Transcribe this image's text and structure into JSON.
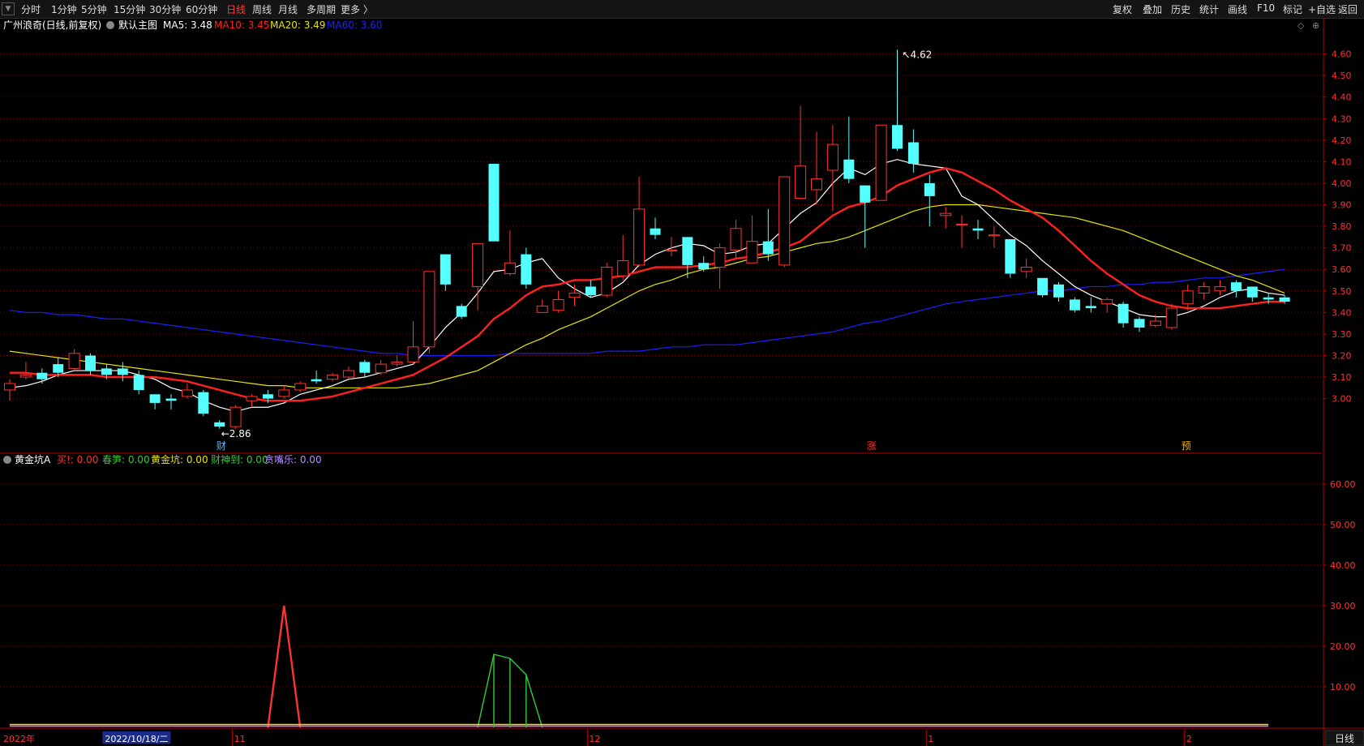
{
  "toolbar": {
    "logo": "▼",
    "periods": [
      "分时",
      "1分钟",
      "5分钟",
      "15分钟",
      "30分钟",
      "60分钟",
      "日线",
      "周线",
      "月线",
      "多周期",
      "更多 〉"
    ],
    "active_period": "日线",
    "right_buttons": [
      "复权",
      "叠加",
      "历史",
      "统计",
      "画线",
      "F10",
      "标记",
      "+自选",
      "返回"
    ]
  },
  "main_legend": {
    "stock": "广州浪奇(日线,前复权)",
    "template": "默认主图",
    "ma5": "MA5: 3.48",
    "ma10": "MA10: 3.45",
    "ma20": "MA20: 3.49",
    "ma60": "MA60: 3.60"
  },
  "sub_legend": {
    "name": "黄金坑A",
    "items": [
      {
        "text": "买!: 0.00",
        "color": "#ff3333"
      },
      {
        "text": "春笋: 0.00",
        "color": "#33cc33"
      },
      {
        "text": "黄金坑: 0.00",
        "color": "#e6e600"
      },
      {
        "text": "财神到: 0.00",
        "color": "#33cc33"
      },
      {
        "text": "贪嘴乐: 0.00",
        "color": "#b28dff"
      }
    ]
  },
  "markers": {
    "high": "4.62",
    "low": "2.86",
    "cai": "财",
    "zhang": "涨",
    "yu": "预"
  },
  "x_axis": {
    "labels": [
      {
        "text": "2022年",
        "i": 0
      },
      {
        "text": "2022/10/18/二",
        "i": 6
      },
      {
        "text": "11",
        "i": 14
      },
      {
        "text": "12",
        "i": 36
      },
      {
        "text": "1",
        "i": 57
      },
      {
        "text": "2",
        "i": 73
      }
    ]
  },
  "period_tag": "日线",
  "colors": {
    "up": "#ff3232",
    "down": "#54ffff",
    "ma5": "#ffffff",
    "ma10": "#ff2020",
    "ma20": "#e6e600",
    "ma60": "#1e1eff",
    "grid": "#7a0000",
    "axis": "#b40000"
  },
  "chart_data": [
    {
      "type": "candlestick",
      "title": "广州浪奇(日线,前复权)",
      "ylim": [
        2.75,
        4.7
      ],
      "yticks": [
        3.0,
        3.1,
        3.2,
        3.3,
        3.4,
        3.5,
        3.6,
        3.7,
        3.8,
        3.9,
        4.0,
        4.1,
        4.2,
        4.3,
        4.4,
        4.5,
        4.6
      ],
      "candles": [
        [
          3.04,
          3.07,
          3.09,
          2.99
        ],
        [
          3.1,
          3.11,
          3.17,
          3.09
        ],
        [
          3.12,
          3.09,
          3.14,
          3.07
        ],
        [
          3.16,
          3.12,
          3.19,
          3.1
        ],
        [
          3.14,
          3.21,
          3.23,
          3.13
        ],
        [
          3.2,
          3.13,
          3.21,
          3.11
        ],
        [
          3.14,
          3.11,
          3.16,
          3.09
        ],
        [
          3.14,
          3.11,
          3.17,
          3.08
        ],
        [
          3.11,
          3.04,
          3.13,
          3.02
        ],
        [
          3.02,
          2.98,
          3.02,
          2.95
        ],
        [
          3.0,
          2.99,
          3.02,
          2.95
        ],
        [
          3.01,
          3.04,
          3.07,
          3.0
        ],
        [
          3.03,
          2.93,
          3.04,
          2.92
        ],
        [
          2.89,
          2.87,
          2.9,
          2.86
        ],
        [
          2.87,
          2.96,
          2.97,
          2.86
        ],
        [
          2.99,
          3.01,
          3.02,
          2.96
        ],
        [
          3.02,
          3.0,
          3.04,
          2.98
        ],
        [
          3.01,
          3.04,
          3.06,
          3.0
        ],
        [
          3.04,
          3.07,
          3.08,
          3.03
        ],
        [
          3.09,
          3.08,
          3.13,
          3.07
        ],
        [
          3.09,
          3.11,
          3.12,
          3.08
        ],
        [
          3.1,
          3.13,
          3.15,
          3.09
        ],
        [
          3.17,
          3.12,
          3.18,
          3.1
        ],
        [
          3.12,
          3.16,
          3.18,
          3.11
        ],
        [
          3.16,
          3.17,
          3.2,
          3.15
        ],
        [
          3.17,
          3.24,
          3.36,
          3.16
        ],
        [
          3.24,
          3.59,
          3.59,
          3.21
        ],
        [
          3.67,
          3.53,
          3.67,
          3.5
        ],
        [
          3.43,
          3.38,
          3.44,
          3.37
        ],
        [
          3.52,
          3.72,
          3.72,
          3.41
        ],
        [
          4.09,
          3.73,
          4.09,
          3.73
        ],
        [
          3.58,
          3.63,
          3.78,
          3.57
        ],
        [
          3.67,
          3.53,
          3.7,
          3.51
        ],
        [
          3.4,
          3.43,
          3.46,
          3.4
        ],
        [
          3.41,
          3.46,
          3.5,
          3.4
        ],
        [
          3.47,
          3.49,
          3.53,
          3.43
        ],
        [
          3.52,
          3.48,
          3.55,
          3.47
        ],
        [
          3.48,
          3.61,
          3.63,
          3.47
        ],
        [
          3.57,
          3.64,
          3.76,
          3.55
        ],
        [
          3.62,
          3.88,
          4.03,
          3.61
        ],
        [
          3.79,
          3.76,
          3.84,
          3.74
        ],
        [
          3.69,
          3.69,
          3.75,
          3.66
        ],
        [
          3.75,
          3.62,
          3.75,
          3.56
        ],
        [
          3.63,
          3.6,
          3.66,
          3.59
        ],
        [
          3.61,
          3.7,
          3.72,
          3.51
        ],
        [
          3.69,
          3.79,
          3.83,
          3.65
        ],
        [
          3.63,
          3.73,
          3.85,
          3.63
        ],
        [
          3.73,
          3.67,
          3.88,
          3.64
        ],
        [
          3.62,
          4.03,
          4.03,
          3.61
        ],
        [
          3.93,
          4.08,
          4.36,
          3.93
        ],
        [
          3.97,
          4.02,
          4.24,
          3.9
        ],
        [
          4.06,
          4.18,
          4.27,
          3.87
        ],
        [
          4.11,
          4.02,
          4.31,
          4.0
        ],
        [
          3.99,
          3.91,
          3.99,
          3.7
        ],
        [
          3.92,
          4.27,
          4.27,
          3.92
        ],
        [
          4.27,
          4.16,
          4.62,
          4.15
        ],
        [
          4.19,
          4.09,
          4.25,
          4.05
        ],
        [
          4.0,
          3.94,
          4.04,
          3.8
        ],
        [
          3.85,
          3.86,
          3.89,
          3.79
        ],
        [
          3.81,
          3.81,
          3.85,
          3.7
        ],
        [
          3.79,
          3.78,
          3.83,
          3.74
        ],
        [
          3.76,
          3.76,
          3.8,
          3.7
        ],
        [
          3.74,
          3.58,
          3.74,
          3.56
        ],
        [
          3.59,
          3.61,
          3.65,
          3.56
        ],
        [
          3.56,
          3.48,
          3.56,
          3.47
        ],
        [
          3.53,
          3.47,
          3.54,
          3.45
        ],
        [
          3.46,
          3.41,
          3.47,
          3.4
        ],
        [
          3.43,
          3.42,
          3.47,
          3.4
        ],
        [
          3.44,
          3.46,
          3.47,
          3.4
        ],
        [
          3.44,
          3.35,
          3.45,
          3.33
        ],
        [
          3.37,
          3.33,
          3.38,
          3.31
        ],
        [
          3.34,
          3.36,
          3.39,
          3.33
        ],
        [
          3.33,
          3.42,
          3.44,
          3.32
        ],
        [
          3.44,
          3.5,
          3.53,
          3.41
        ],
        [
          3.49,
          3.52,
          3.54,
          3.46
        ],
        [
          3.5,
          3.52,
          3.55,
          3.48
        ],
        [
          3.54,
          3.5,
          3.55,
          3.47
        ],
        [
          3.52,
          3.47,
          3.52,
          3.45
        ],
        [
          3.47,
          3.46,
          3.49,
          3.44
        ],
        [
          3.47,
          3.45,
          3.48,
          3.44
        ]
      ],
      "series": [
        {
          "name": "MA5",
          "values": [
            3.05,
            3.06,
            3.08,
            3.11,
            3.13,
            3.13,
            3.13,
            3.13,
            3.11,
            3.09,
            3.05,
            3.03,
            2.99,
            2.96,
            2.94,
            2.96,
            2.96,
            2.98,
            3.02,
            3.04,
            3.06,
            3.09,
            3.1,
            3.12,
            3.14,
            3.16,
            3.24,
            3.33,
            3.4,
            3.49,
            3.59,
            3.6,
            3.63,
            3.65,
            3.56,
            3.51,
            3.47,
            3.49,
            3.54,
            3.62,
            3.67,
            3.7,
            3.72,
            3.71,
            3.67,
            3.68,
            3.71,
            3.72,
            3.79,
            3.86,
            3.91,
            4.0,
            4.07,
            4.04,
            4.09,
            4.11,
            4.09,
            4.08,
            4.07,
            3.94,
            3.9,
            3.83,
            3.76,
            3.71,
            3.64,
            3.58,
            3.52,
            3.48,
            3.45,
            3.42,
            3.39,
            3.38,
            3.38,
            3.4,
            3.43,
            3.47,
            3.5,
            3.51,
            3.49,
            3.48
          ]
        },
        {
          "name": "MA10",
          "values": [
            3.12,
            3.12,
            3.11,
            3.11,
            3.11,
            3.11,
            3.1,
            3.1,
            3.1,
            3.1,
            3.09,
            3.08,
            3.06,
            3.04,
            3.02,
            3.0,
            2.99,
            2.99,
            2.99,
            3.0,
            3.01,
            3.03,
            3.05,
            3.07,
            3.09,
            3.11,
            3.15,
            3.19,
            3.24,
            3.29,
            3.37,
            3.42,
            3.48,
            3.52,
            3.53,
            3.55,
            3.55,
            3.56,
            3.57,
            3.59,
            3.61,
            3.61,
            3.61,
            3.62,
            3.63,
            3.65,
            3.66,
            3.68,
            3.7,
            3.73,
            3.79,
            3.85,
            3.89,
            3.91,
            3.94,
            3.99,
            4.02,
            4.05,
            4.07,
            4.05,
            4.01,
            3.97,
            3.92,
            3.88,
            3.84,
            3.78,
            3.71,
            3.64,
            3.58,
            3.53,
            3.48,
            3.45,
            3.43,
            3.42,
            3.42,
            3.42,
            3.43,
            3.44,
            3.45,
            3.45
          ]
        },
        {
          "name": "MA20",
          "values": [
            3.22,
            3.21,
            3.2,
            3.19,
            3.18,
            3.17,
            3.16,
            3.15,
            3.14,
            3.13,
            3.12,
            3.11,
            3.1,
            3.09,
            3.08,
            3.07,
            3.06,
            3.06,
            3.05,
            3.05,
            3.05,
            3.05,
            3.05,
            3.05,
            3.05,
            3.06,
            3.07,
            3.09,
            3.11,
            3.13,
            3.17,
            3.21,
            3.25,
            3.28,
            3.32,
            3.35,
            3.38,
            3.42,
            3.46,
            3.5,
            3.53,
            3.55,
            3.58,
            3.6,
            3.61,
            3.63,
            3.65,
            3.66,
            3.68,
            3.7,
            3.72,
            3.73,
            3.75,
            3.78,
            3.81,
            3.84,
            3.87,
            3.89,
            3.9,
            3.9,
            3.9,
            3.89,
            3.88,
            3.87,
            3.86,
            3.85,
            3.84,
            3.82,
            3.8,
            3.78,
            3.75,
            3.72,
            3.69,
            3.66,
            3.63,
            3.6,
            3.57,
            3.55,
            3.52,
            3.49
          ]
        },
        {
          "name": "MA60",
          "values": [
            3.41,
            3.4,
            3.4,
            3.39,
            3.39,
            3.38,
            3.37,
            3.37,
            3.36,
            3.35,
            3.34,
            3.33,
            3.32,
            3.31,
            3.3,
            3.29,
            3.28,
            3.27,
            3.26,
            3.25,
            3.24,
            3.23,
            3.22,
            3.21,
            3.21,
            3.2,
            3.2,
            3.2,
            3.2,
            3.2,
            3.2,
            3.21,
            3.21,
            3.21,
            3.21,
            3.21,
            3.21,
            3.22,
            3.22,
            3.22,
            3.23,
            3.24,
            3.24,
            3.25,
            3.25,
            3.25,
            3.26,
            3.27,
            3.28,
            3.29,
            3.3,
            3.31,
            3.33,
            3.35,
            3.36,
            3.38,
            3.4,
            3.42,
            3.44,
            3.45,
            3.46,
            3.47,
            3.48,
            3.49,
            3.5,
            3.5,
            3.51,
            3.52,
            3.52,
            3.53,
            3.53,
            3.54,
            3.54,
            3.55,
            3.56,
            3.56,
            3.57,
            3.58,
            3.59,
            3.6
          ]
        }
      ]
    },
    {
      "type": "line",
      "title": "黄金坑A",
      "ylim": [
        0,
        66
      ],
      "yticks": [
        10,
        20,
        30,
        40,
        50,
        60
      ],
      "series": [
        {
          "name": "买!",
          "values": [
            [
              16,
              0
            ],
            [
              17,
              30
            ],
            [
              18,
              0
            ]
          ]
        },
        {
          "name": "春笋",
          "values": [
            [
              29,
              0
            ],
            [
              30,
              18
            ],
            [
              31,
              17
            ],
            [
              32,
              13
            ],
            [
              33,
              0
            ]
          ]
        },
        {
          "name": "黄金坑",
          "values": [
            [
              0,
              0.7
            ],
            [
              78,
              0.7
            ]
          ]
        },
        {
          "name": "贪嘴乐",
          "values": [
            [
              0,
              0.3
            ],
            [
              78,
              0.3
            ]
          ]
        }
      ]
    }
  ]
}
